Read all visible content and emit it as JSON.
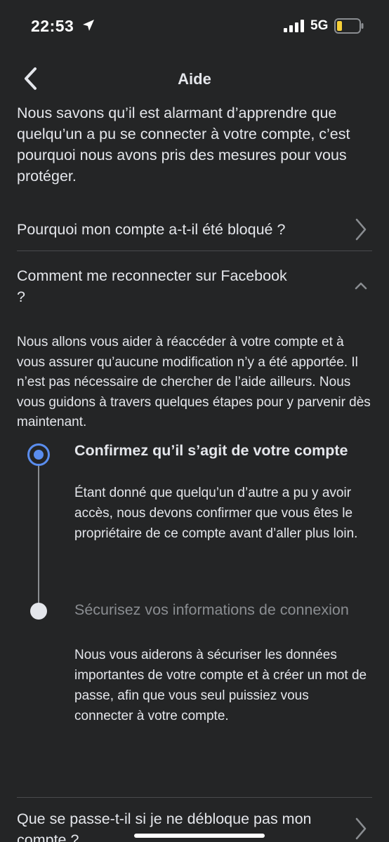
{
  "status_bar": {
    "time": "22:53",
    "network": "5G",
    "icons": [
      "location-arrow-icon",
      "signal-bars-icon",
      "battery-low-icon"
    ]
  },
  "nav": {
    "title": "Aide",
    "back_icon": "chevron-left-icon"
  },
  "intro_text": "Nous savons qu’il est alarmant d’apprendre que quelqu’un a pu se connecter à votre compte, c’est pourquoi nous avons pris des mesures pour vous protéger.",
  "faq": {
    "item1": "Pourquoi mon compte a-t-il été bloqué ?",
    "item2": "Comment me reconnecter sur Facebook ?",
    "item2_body": "Nous allons vous aider à réaccéder à votre compte et à vous assurer qu’aucune modification n’y a été apportée. Il n’est pas nécessaire de chercher de l’aide ailleurs. Nous vous guidons à travers quelques étapes pour y parvenir dès maintenant.",
    "item3": "Que se passe-t-il si je ne débloque pas mon compte ?"
  },
  "steps": [
    {
      "title": "Confirmez qu’il s’agit de votre compte",
      "body": "Étant donné que quelqu’un d’autre a pu y avoir accès, nous devons confirmer que vous êtes le propriétaire de ce compte avant d’aller plus loin.",
      "state": "active"
    },
    {
      "title": "Sécurisez vos informations de connexion",
      "body": "Nous vous aiderons à sécuriser les données importantes de votre compte et à créer un mot de passe, afin que vous seul puissiez vous connecter à votre compte.",
      "state": "inactive"
    }
  ],
  "colors": {
    "background": "#242526",
    "text": "#e4e6eb",
    "muted": "#8a8d91",
    "accent": "#5a8dee",
    "battery": "#f7d038"
  }
}
